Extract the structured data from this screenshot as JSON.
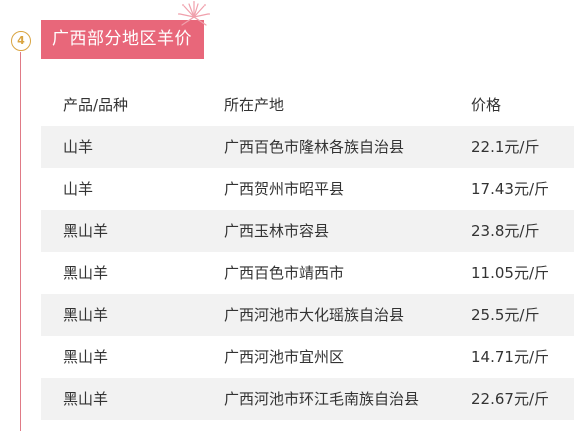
{
  "section": {
    "number": "4",
    "title": "广西部分地区羊价"
  },
  "table": {
    "headers": [
      "产品/品种",
      "所在产地",
      "价格"
    ],
    "rows": [
      [
        "山羊",
        "广西百色市隆林各族自治县",
        "22.1元/斤"
      ],
      [
        "山羊",
        "广西贺州市昭平县",
        "17.43元/斤"
      ],
      [
        "黑山羊",
        "广西玉林市容县",
        "23.8元/斤"
      ],
      [
        "黑山羊",
        "广西百色市靖西市",
        "11.05元/斤"
      ],
      [
        "黑山羊",
        "广西河池市大化瑶族自治县",
        "25.5元/斤"
      ],
      [
        "黑山羊",
        "广西河池市宜州区",
        "14.71元/斤"
      ],
      [
        "黑山羊",
        "广西河池市环江毛南族自治县",
        "22.67元/斤"
      ]
    ]
  },
  "colors": {
    "accent": "#e8677a",
    "badge": "#d9a441",
    "row_shade": "#f2f2f2"
  }
}
